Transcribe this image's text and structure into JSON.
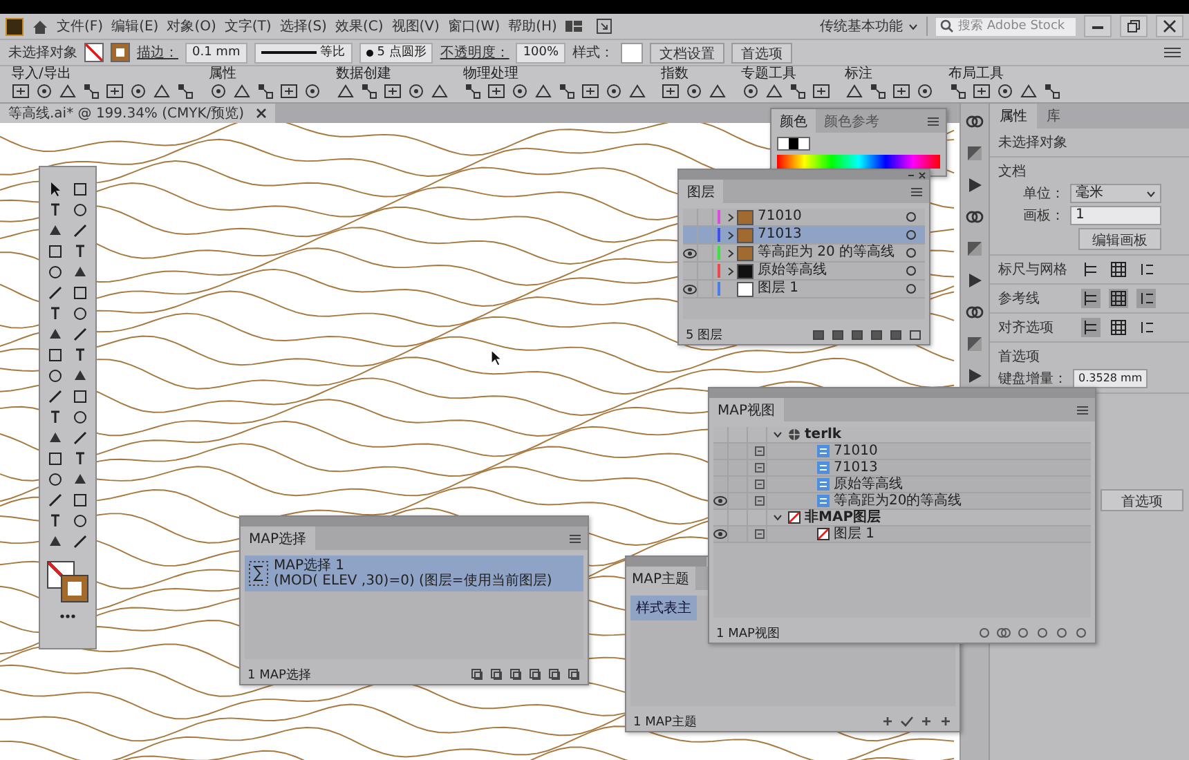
{
  "menu": [
    "文件(F)",
    "编辑(E)",
    "对象(O)",
    "文字(T)",
    "选择(S)",
    "效果(C)",
    "视图(V)",
    "窗口(W)",
    "帮助(H)"
  ],
  "workspace": "传统基本功能",
  "search": {
    "placeholder": "搜索 Adobe Stock"
  },
  "control_bar": {
    "selection": "未选择对象",
    "stroke_label": "描边：",
    "stroke_value": "0.1 mm",
    "profile": "等比",
    "brush": "5 点圆形",
    "opacity_label": "不透明度：",
    "opacity_value": "100%",
    "style_label": "样式：",
    "buttons": [
      "文档设置",
      "首选项"
    ]
  },
  "plugin_groups": [
    {
      "label": "导入/导出"
    },
    {
      "label": "属性"
    },
    {
      "label": "数据创建"
    },
    {
      "label": "物理处理"
    },
    {
      "label": "指数"
    },
    {
      "label": "专题工具"
    },
    {
      "label": "标注"
    },
    {
      "label": "布局工具"
    }
  ],
  "document_tab": {
    "title": "等高线.ai* @ 199.34% (CMYK/预览)"
  },
  "color_panel": {
    "tabs": [
      {
        "label": "颜色",
        "selected": true
      },
      {
        "label": "颜色参考",
        "selected": false
      }
    ]
  },
  "layers_panel": {
    "title": "图层",
    "layers": [
      {
        "name": "71010",
        "color": "#e048e0",
        "visible": false,
        "selected": false
      },
      {
        "name": "71013",
        "color": "#4050e8",
        "visible": false,
        "selected": true
      },
      {
        "name": "等高距为 20 的等高线",
        "color": "#40e040",
        "visible": true,
        "selected": false
      },
      {
        "name": "原始等高线",
        "color": "#f04848",
        "visible": false,
        "selected": false
      },
      {
        "name": "图层 1",
        "color": "#4a7ef0",
        "visible": true,
        "selected": false
      }
    ],
    "footer": "5 图层"
  },
  "map_view_panel": {
    "title": "MAP视图",
    "tree": [
      {
        "name": "terlk",
        "kind": "map",
        "expanded": true,
        "children": [
          {
            "name": "71010",
            "visible": false
          },
          {
            "name": "71013",
            "visible": false
          },
          {
            "name": "原始等高线",
            "visible": false
          },
          {
            "name": "等高距为20的等高线",
            "visible": true
          }
        ]
      },
      {
        "name": "非MAP图层",
        "kind": "nonmap",
        "expanded": true,
        "children": [
          {
            "name": "图层 1",
            "visible": true
          }
        ]
      }
    ],
    "footer": "1 MAP视图"
  },
  "map_select_panel": {
    "title": "MAP选择",
    "items": [
      {
        "name": "MAP选择 1",
        "expression": "(MOD( ELEV ,30)=0) (图层=使用当前图层)",
        "selected": true
      }
    ],
    "footer": "1 MAP选择"
  },
  "map_theme_panel": {
    "title": "MAP主题",
    "items": [
      {
        "name": "样式表主",
        "selected": true
      }
    ],
    "footer": "1 MAP主题"
  },
  "properties_panel": {
    "tabs": [
      {
        "label": "属性",
        "selected": true
      },
      {
        "label": "库",
        "selected": false
      }
    ],
    "selection": "未选择对象",
    "document_heading": "文档",
    "unit_label": "单位：",
    "unit_value": "毫米",
    "artboard_label": "画板：",
    "artboard_value": "1",
    "edit_artboards": "编辑画板",
    "rows": [
      {
        "label": "标尺与网格",
        "toggles": [
          {
            "selected": false
          },
          {
            "selected": false
          },
          {
            "selected": false
          }
        ]
      },
      {
        "label": "参考线",
        "toggles": [
          {
            "selected": true
          },
          {
            "selected": true
          },
          {
            "selected": true
          }
        ]
      },
      {
        "label": "对齐选项",
        "toggles": [
          {
            "selected": true
          },
          {
            "selected": false
          },
          {
            "selected": false
          }
        ]
      }
    ],
    "preferences_heading": "首选项",
    "keyboard_label": "键盘增量：",
    "keyboard_value": "0.3528 mm",
    "preferences_button": "首选项"
  }
}
